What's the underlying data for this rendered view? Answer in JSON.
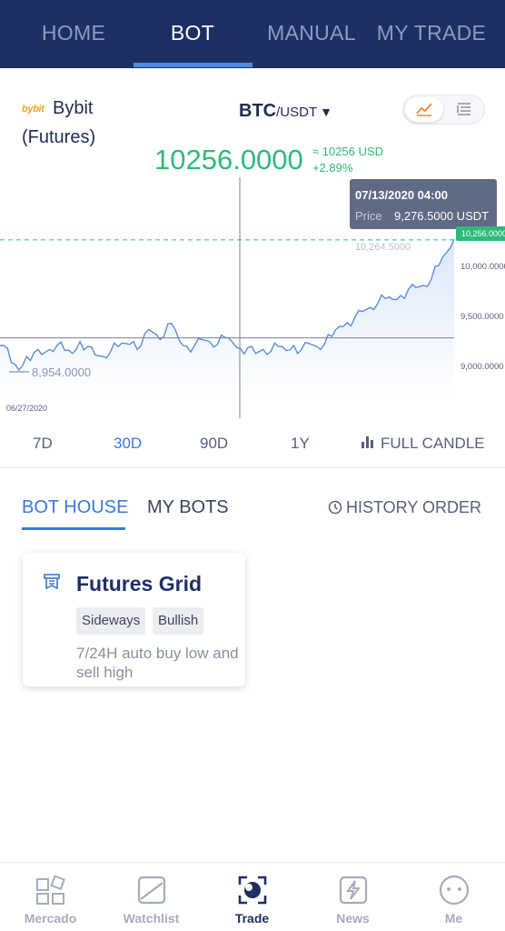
{
  "top_nav": {
    "tabs": [
      {
        "label": "HOME",
        "active": false
      },
      {
        "label": "BOT",
        "active": true
      },
      {
        "label": "MANUAL",
        "active": false
      },
      {
        "label": "MY TRADE",
        "active": false
      }
    ]
  },
  "exchange": {
    "logo_text": "bybit",
    "name": "Bybit",
    "type": "(Futures)"
  },
  "pair": {
    "base": "BTC",
    "quote": "/USDT",
    "caret": "▼"
  },
  "view_toggle": {
    "selected": "chart",
    "icons": [
      "line-chart-icon",
      "list-icon"
    ]
  },
  "price": {
    "last": "10256.0000",
    "approx": "≈ 10256 USD",
    "change": "+2.89%"
  },
  "chart_data": {
    "type": "line",
    "x_start": "06/27/2020",
    "x_end": "07/14/2020",
    "y_ticks": [
      "10,000.0000",
      "9,500.0000",
      "9,000.0000"
    ],
    "y_partial_tick": "10,264.5000",
    "ylim": [
      8700,
      10700
    ],
    "min_label": "8,954.0000",
    "date_label": "06/27/2020",
    "last_price_tag": "10,256.0000",
    "crosshair_price": 9276.5,
    "series": [
      {
        "values": [
          9200,
          9030,
          8954,
          9090,
          9130,
          9110,
          9160,
          9200,
          9150,
          9120,
          9240,
          9190,
          9105,
          9090,
          9140,
          9190,
          9220,
          9240,
          9200,
          9360,
          9310,
          9290,
          9420,
          9250,
          9190,
          9200,
          9260,
          9240,
          9210,
          9280,
          9230,
          9170,
          9180,
          9120,
          9160,
          9140,
          9190,
          9150,
          9200,
          9160,
          9220,
          9190,
          9210,
          9290,
          9390,
          9430,
          9480,
          9540,
          9580,
          9620,
          9670,
          9660,
          9700,
          9760,
          9780,
          9800,
          9860,
          10000,
          10130,
          10264
        ]
      }
    ],
    "tooltip": {
      "date": "07/13/2020 04:00",
      "label": "Price",
      "value": "9,276.5000 USDT"
    },
    "colors": {
      "line": "#5b8fd6",
      "fill": "#e9f0fb",
      "dashed": "#2eba7a"
    }
  },
  "ranges": [
    {
      "label": "7D",
      "active": false
    },
    {
      "label": "30D",
      "active": true
    },
    {
      "label": "90D",
      "active": false
    },
    {
      "label": "1Y",
      "active": false
    }
  ],
  "full_candle": "FULL CANDLE",
  "bot_tabs": [
    {
      "label": "BOT HOUSE",
      "active": true
    },
    {
      "label": "MY BOTS",
      "active": false
    }
  ],
  "history_order": "HISTORY ORDER",
  "card": {
    "title": "Futures Grid",
    "tags": [
      "Sideways",
      "Bullish"
    ],
    "description": "7/24H auto buy low and sell high"
  },
  "bottom_nav": [
    {
      "label": "Mercado",
      "icon": "grid-icon",
      "active": false
    },
    {
      "label": "Watchlist",
      "icon": "watchlist-icon",
      "active": false
    },
    {
      "label": "Trade",
      "icon": "trade-icon",
      "active": true
    },
    {
      "label": "News",
      "icon": "news-icon",
      "active": false
    },
    {
      "label": "Me",
      "icon": "profile-icon",
      "active": false
    }
  ],
  "colors": {
    "nav_bg": "#1e2f63",
    "accent": "#3a78d8",
    "positive": "#2eba7a"
  }
}
